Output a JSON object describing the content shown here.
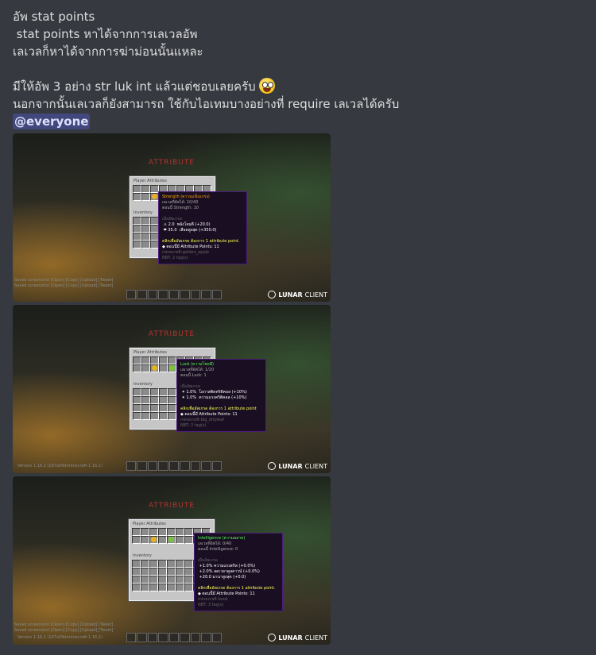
{
  "message": {
    "lines": [
      "อัพ stat points",
      " stat points หาได้จากการเลเวลอัพ",
      "เลเวลก็หาได้จากการฆ่าม่อนนั้นแหละ",
      "",
      "มีให้อัพ 3 อย่าง str luk int แล้วแต่ชอบเลยครับ",
      "นอกจากนั้นเลเวลก็ยังสามารถ ใช้กับไอเทมบางอย่างที่ require เลเวลได้ครับ"
    ],
    "emoji": "grinning-face-emoji",
    "mention": "@everyone"
  },
  "screenshots": [
    {
      "attr_title": "ATTRIBUTE",
      "gui_title": "Player Attributes",
      "inventory_label": "Inventory",
      "tooltip": {
        "name": "Strength (ความแข็งแกร่ง)",
        "lines": [
          {
            "text": "เลเวลที่อัพได้: 10/40",
            "color": "c-gray"
          },
          {
            "text": "ตอนนี้ Strength: 10",
            "color": "c-gray"
          },
          {
            "text": "",
            "color": "c-gray"
          },
          {
            "text": "เมื่ออัพเกรด",
            "color": "c-dark"
          },
          {
            "text": " ⚔ 2.0  พลังโจมตี (+20.0)",
            "color": "c-white"
          },
          {
            "text": " ❤ 35.0  เลือดสูงสุด (+350.0)",
            "color": "c-white"
          },
          {
            "text": "",
            "color": "c-gray"
          },
          {
            "text": "คลิกเพื่ออัพเกรด ต้องการ 1 attribute point.",
            "color": "c-yellow"
          },
          {
            "text": "◆ ตอนนี้มี Attribute Points: 11",
            "color": "c-white"
          },
          {
            "text": "minecraft:golden_apple",
            "color": "c-dark"
          },
          {
            "text": "NBT: 2 tag(s)",
            "color": "c-dark"
          }
        ]
      },
      "chat": [
        "Saved screenshot [Open] [Copy] [Upload] [Tweet]",
        "Saved screenshot [Open] [Copy] [Upload] [Tweet]"
      ],
      "version": "Version 1.16.1 (167a39d/minecraft-1.16.1)",
      "brand": "LUNAR",
      "brand_light": "CLIENT"
    },
    {
      "attr_title": "ATTRIBUTE",
      "gui_title": "Player Attributes",
      "inventory_label": "Inventory",
      "tooltip": {
        "name": "Luck (ความโชคดี)",
        "lines": [
          {
            "text": "เลเวลที่อัพได้: 1/20",
            "color": "c-gray"
          },
          {
            "text": "ตอนนี้ Luck: 1",
            "color": "c-gray"
          },
          {
            "text": "",
            "color": "c-gray"
          },
          {
            "text": "เมื่ออัพเกรด",
            "color": "c-dark"
          },
          {
            "text": " ✦ 1.0%  โอกาสติดคริติคอล (+10%)",
            "color": "c-white"
          },
          {
            "text": " ✦ 1.0%  ความแรงคริติคอล (+10%)",
            "color": "c-white"
          },
          {
            "text": "",
            "color": "c-gray"
          },
          {
            "text": "คลิกเพื่ออัพเกรด ต้องการ 1 attribute point",
            "color": "c-yellow"
          },
          {
            "text": "◆ ตอนนี้มี Attribute Points: 11",
            "color": "c-white"
          },
          {
            "text": "minecraft:big_dripleaf",
            "color": "c-dark"
          },
          {
            "text": "NBT: 2 tag(s)",
            "color": "c-dark"
          }
        ]
      },
      "chat": [],
      "version": "Version 1.16.1 (167a39d/minecraft-1.16.1)",
      "brand": "LUNAR",
      "brand_light": "CLIENT"
    },
    {
      "attr_title": "ATTRIBUTE",
      "gui_title": "Player Attributes",
      "inventory_label": "Inventory",
      "tooltip": {
        "name": "Intelligence (ความฉลาด)",
        "lines": [
          {
            "text": "เลเวลที่อัพได้: 0/40",
            "color": "c-gray"
          },
          {
            "text": "ตอนนี้ Intelligence: 0",
            "color": "c-gray"
          },
          {
            "text": "",
            "color": "c-gray"
          },
          {
            "text": "เมื่ออัพเกรด",
            "color": "c-dark"
          },
          {
            "text": " +1.0% ความแรงสกิล (+0.0%)",
            "color": "c-white"
          },
          {
            "text": " +2.0% ลดเวลาคูลดาวน์ (+0.0%)",
            "color": "c-white"
          },
          {
            "text": " +20.0 มานาสูงสุด (+0.0)",
            "color": "c-white"
          },
          {
            "text": "",
            "color": "c-gray"
          },
          {
            "text": "คลิกเพื่ออัพเกรด ต้องการ 1 attribute point.",
            "color": "c-yellow"
          },
          {
            "text": "◆ ตอนนี้มี Attribute Points: 11",
            "color": "c-white"
          },
          {
            "text": "minecraft:book",
            "color": "c-dark"
          },
          {
            "text": "NBT: 3 tag(s)",
            "color": "c-dark"
          }
        ]
      },
      "chat": [
        "Saved screenshot [Open] [Copy] [Upload] [Tweet]",
        "Saved screenshot [Open] [Copy] [Upload] [Tweet]"
      ],
      "version": "Version 1.16.1 (167a39d/minecraft-1.16.1)",
      "brand": "LUNAR",
      "brand_light": "CLIENT"
    }
  ]
}
